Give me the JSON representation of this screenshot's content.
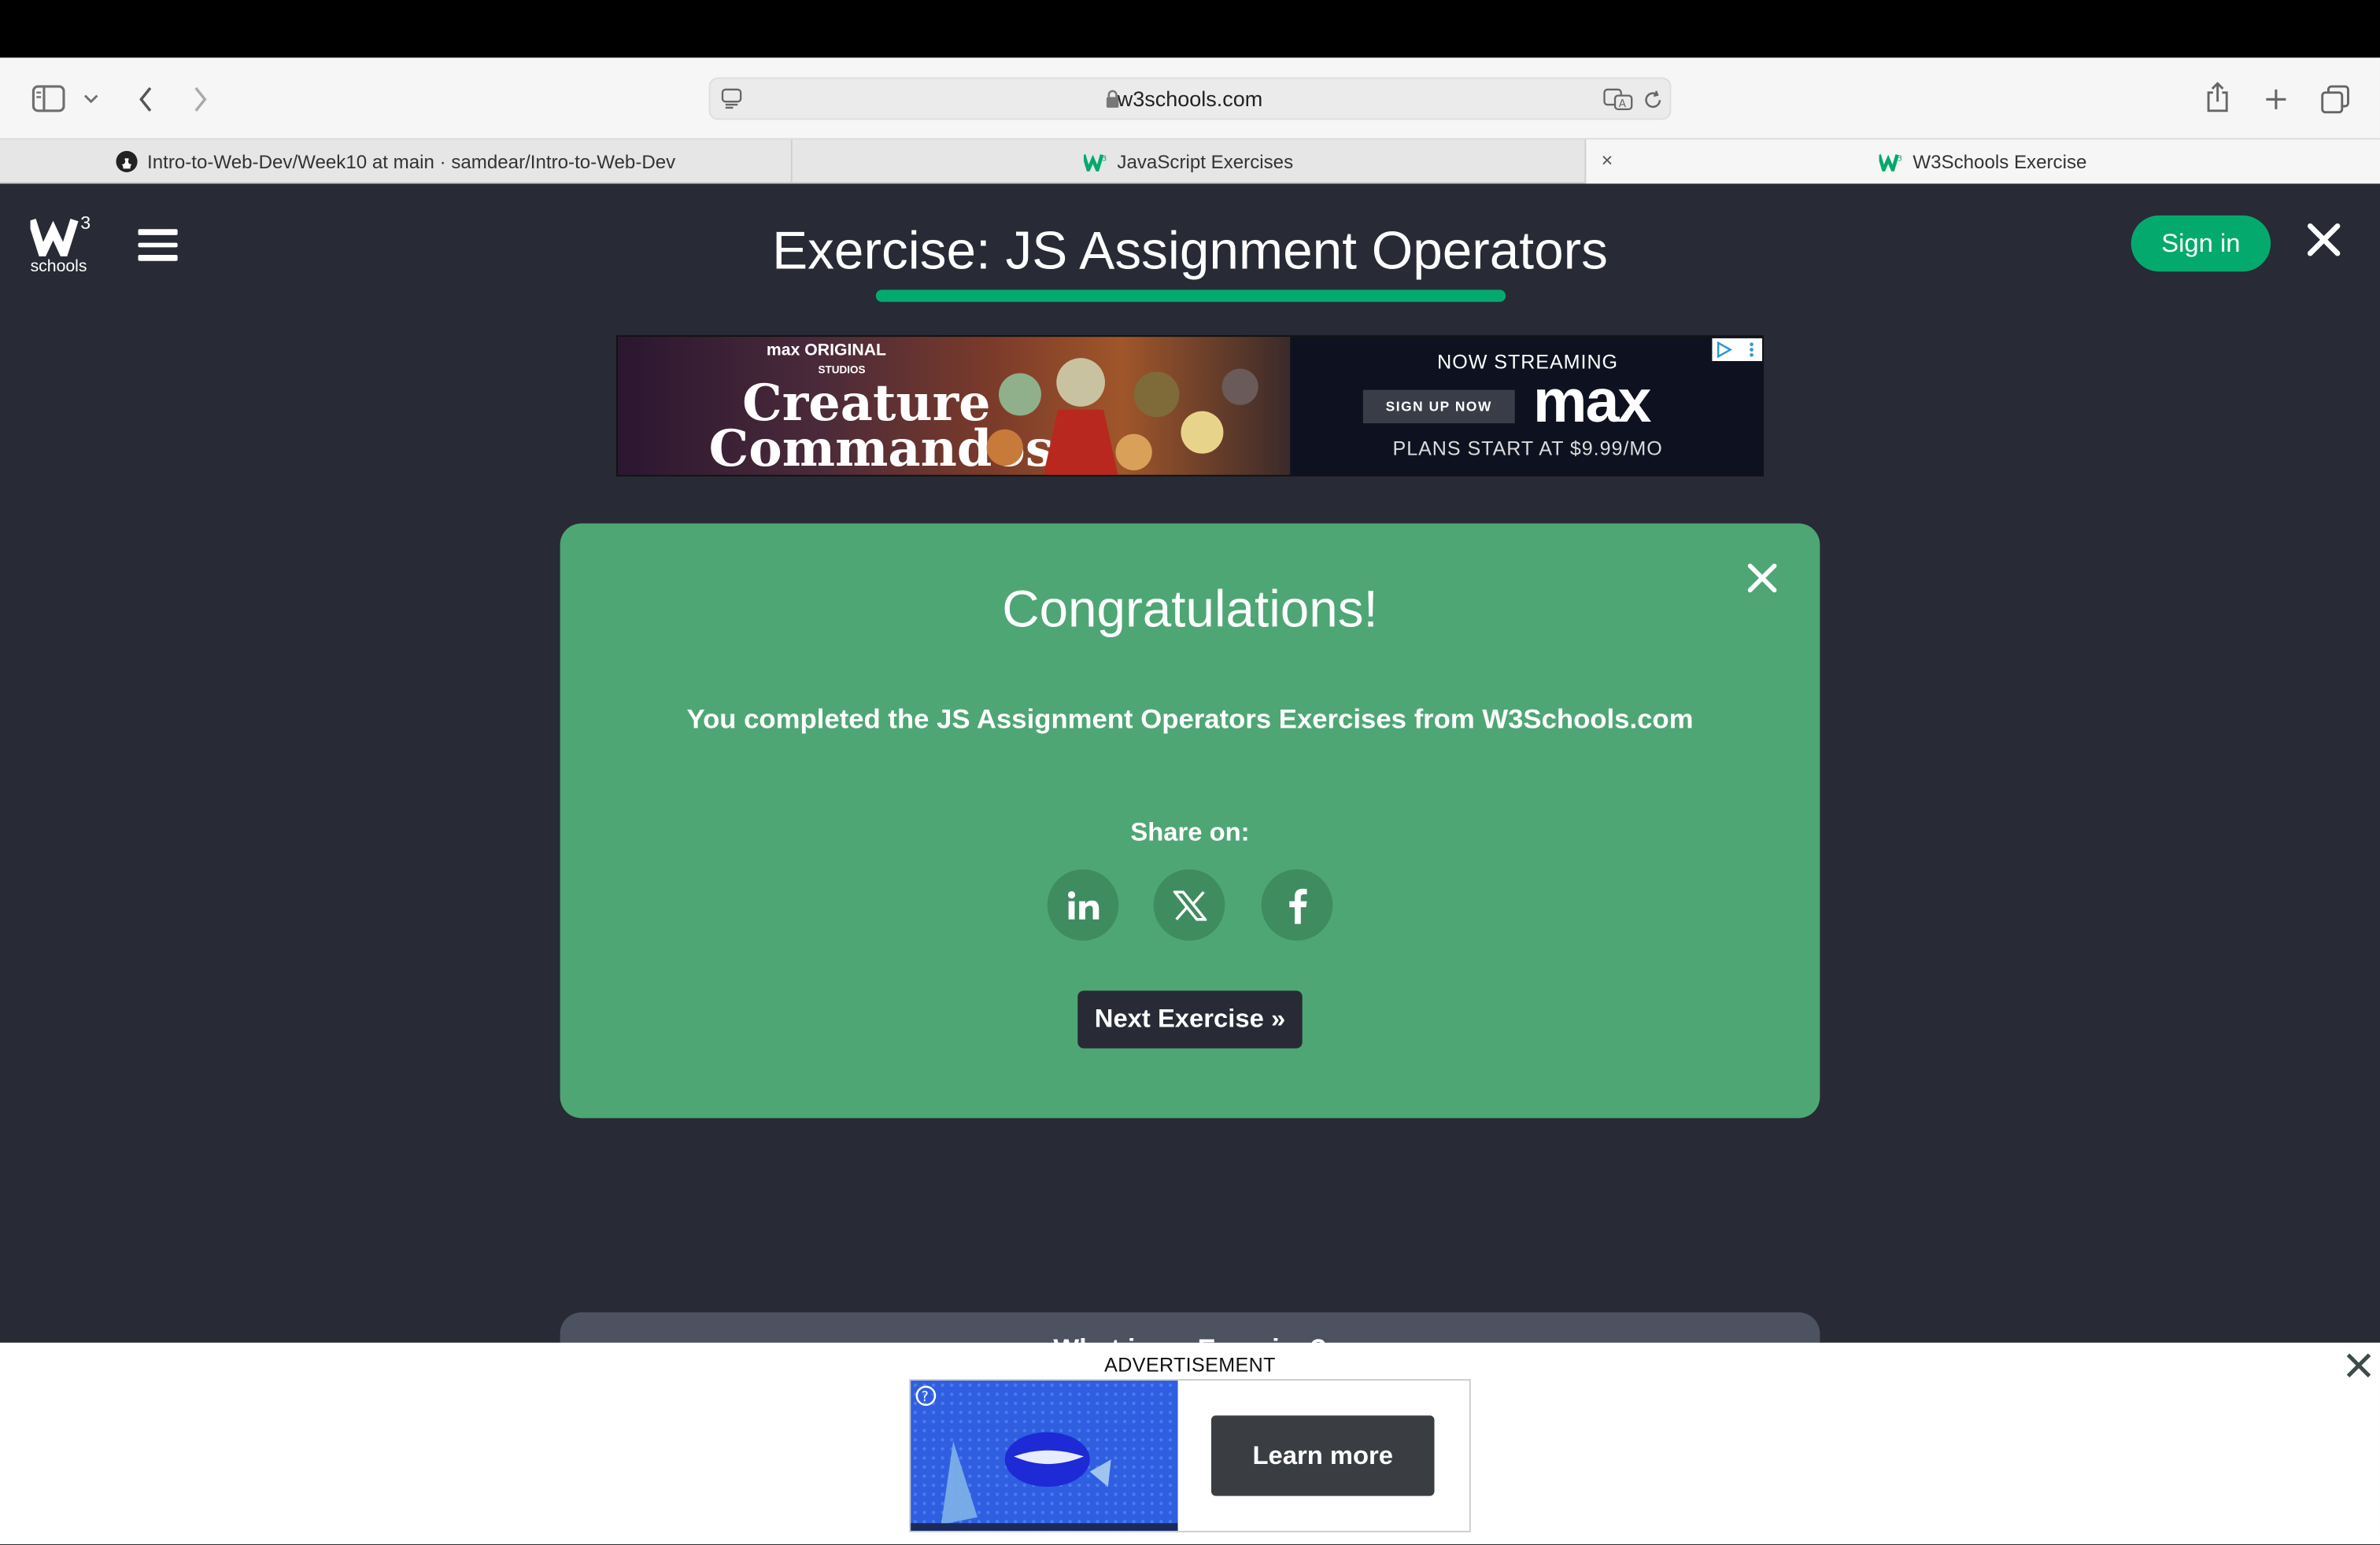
{
  "browser": {
    "url": "w3schools.com",
    "tabs": [
      {
        "label": "Intro-to-Web-Dev/Week10 at main · samdear/Intro-to-Web-Dev",
        "favicon": "github-icon"
      },
      {
        "label": "JavaScript Exercises",
        "favicon": "w3schools-icon"
      },
      {
        "label": "W3Schools Exercise",
        "favicon": "w3schools-icon"
      }
    ],
    "tab_close_glyph": "×"
  },
  "header": {
    "logo_text": "schools",
    "logo_sup": "3",
    "title": "Exercise: JS Assignment Operators",
    "signin_label": "Sign in"
  },
  "top_ad": {
    "brand_small": "max ORIGINAL",
    "studio": "STUDIOS",
    "show_title_line1": "Creature",
    "show_title_line2": "Commandos",
    "now_streaming": "NOW STREAMING",
    "signup": "SIGN UP NOW",
    "brand": "max",
    "price": "PLANS START AT $9.99/MO"
  },
  "card": {
    "title": "Congratulations!",
    "message": "You completed the JS Assignment Operators Exercises from W3Schools.com",
    "share_label": "Share on:",
    "social": [
      "linkedin-icon",
      "x-icon",
      "facebook-icon"
    ],
    "next_label": "Next Exercise »"
  },
  "next_card_partial": "What is an Exercise?",
  "bottom_ad": {
    "label": "ADVERTISEMENT",
    "cta": "Learn more"
  },
  "colors": {
    "page_bg": "#282a35",
    "accent": "#04aa6d",
    "card_bg": "#4ea674"
  }
}
